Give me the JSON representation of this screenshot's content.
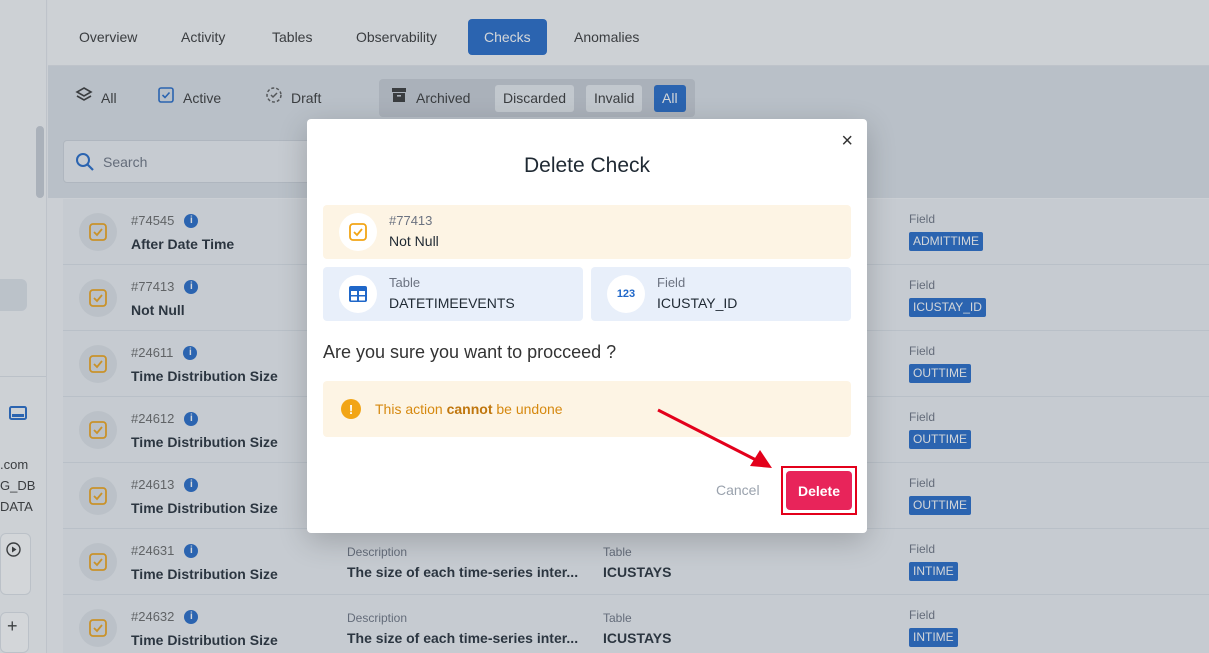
{
  "sidebar": {
    "texts": [
      ".com",
      "G_DB",
      "DATA"
    ],
    "plus_label": "+"
  },
  "tabs": [
    {
      "label": "Overview"
    },
    {
      "label": "Activity"
    },
    {
      "label": "Tables"
    },
    {
      "label": "Observability"
    },
    {
      "label": "Checks",
      "active": true
    },
    {
      "label": "Anomalies"
    }
  ],
  "filters": {
    "all": "All",
    "active": "Active",
    "draft": "Draft",
    "archived": "Archived",
    "discarded": "Discarded",
    "invalid": "Invalid",
    "all_selected": "All"
  },
  "search": {
    "placeholder": "Search"
  },
  "rows": [
    {
      "id": "#74545",
      "name": "After Date Time",
      "field_label": "Field",
      "field": "ADMITTIME"
    },
    {
      "id": "#77413",
      "name": "Not Null",
      "field_label": "Field",
      "field": "ICUSTAY_ID"
    },
    {
      "id": "#24611",
      "name": "Time Distribution Size",
      "field_label": "Field",
      "field": "OUTTIME"
    },
    {
      "id": "#24612",
      "name": "Time Distribution Size",
      "field_label": "Field",
      "field": "OUTTIME"
    },
    {
      "id": "#24613",
      "name": "Time Distribution Size",
      "field_label": "Field",
      "field": "OUTTIME"
    },
    {
      "id": "#24631",
      "name": "Time Distribution Size",
      "desc_label": "Description",
      "desc": "The size of each time-series inter...",
      "table_label": "Table",
      "table": "ICUSTAYS",
      "field_label": "Field",
      "field": "INTIME"
    },
    {
      "id": "#24632",
      "name": "Time Distribution Size",
      "desc_label": "Description",
      "desc": "The size of each time-series inter...",
      "table_label": "Table",
      "table": "ICUSTAYS",
      "field_label": "Field",
      "field": "INTIME"
    }
  ],
  "modal": {
    "title": "Delete Check",
    "close": "×",
    "check_id": "#77413",
    "check_name": "Not Null",
    "table_label": "Table",
    "table_value": "DATETIMEEVENTS",
    "field_label": "Field",
    "field_value": "ICUSTAY_ID",
    "field_icon_text": "123",
    "question": "Are you sure you want to procceed ?",
    "warning_prefix": "This action ",
    "warning_bold": "cannot",
    "warning_suffix": " be undone",
    "warning_icon": "!",
    "cancel": "Cancel",
    "delete": "Delete"
  },
  "colors": {
    "accent": "#1f67c9",
    "delete": "#e8245a",
    "highlight": "#e3001b",
    "warning": "#f2a516",
    "check_icon": "#f2a516"
  }
}
